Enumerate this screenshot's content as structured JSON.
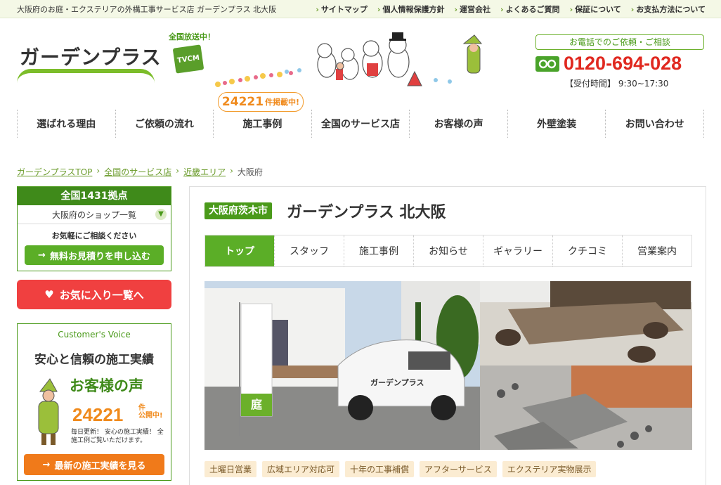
{
  "topbar": {
    "lead": "大阪府のお庭・エクステリアの外構工事サービス店 ガーデンプラス 北大阪",
    "links": [
      "サイトマップ",
      "個人情報保護方針",
      "運営会社",
      "よくあるご質問",
      "保証について",
      "お支払方法について"
    ]
  },
  "header": {
    "logo_text": "ガーデンプラス",
    "tv_label": "全国放送中！",
    "tv_badge": "TVCM",
    "phone_cta": "お電話でのご依頼・ご相談",
    "phone_number": "0120-694-028",
    "hours": "【受付時間】 9:30~17:30"
  },
  "nav": {
    "items": [
      "選ばれる理由",
      "ご依頼の流れ",
      "施工事例",
      "全国のサービス店",
      "お客様の声",
      "外壁塗装",
      "お問い合わせ"
    ],
    "badge_count": "24221",
    "badge_suffix": "件掲載中!"
  },
  "breadcrumb": {
    "items": [
      "ガーデンプラスTOP",
      "全国のサービス店",
      "近畿エリア"
    ],
    "current": "大阪府"
  },
  "sidebar": {
    "shop_count_title": "全国1431拠点",
    "shop_select": "大阪府のショップ一覧",
    "consult_note": "お気軽にご相談ください",
    "estimate_button": "無料お見積りを申し込む",
    "favorites_button": "お気に入り一覧へ",
    "voice": {
      "label": "Customer's Voice",
      "tagline": "安心と信頼の施工実績",
      "title": "お客様の声",
      "count": "24221",
      "count_suffix_1": "件",
      "count_suffix_2": "公開中!",
      "desc": "毎日更新！ 安心の施工実績！ 全施工例ご覧いただけます。",
      "button": "最新の施工実績を見る"
    }
  },
  "main": {
    "city": "大阪府茨木市",
    "shop_name": "ガーデンプラス 北大阪",
    "tabs": [
      "トップ",
      "スタッフ",
      "施工事例",
      "お知らせ",
      "ギャラリー",
      "クチコミ",
      "営業案内"
    ],
    "banner_text": "ガーデンプラス",
    "banner_kanji": "庭",
    "tags": [
      "土曜日営業",
      "広域エリア対応可",
      "十年の工事補償",
      "アフターサービス",
      "エクステリア実物展示"
    ]
  },
  "colors": {
    "brand_green": "#5bae27",
    "phone_red": "#e0281f",
    "accent_orange": "#f08a1c",
    "favorites_red": "#f04040"
  }
}
